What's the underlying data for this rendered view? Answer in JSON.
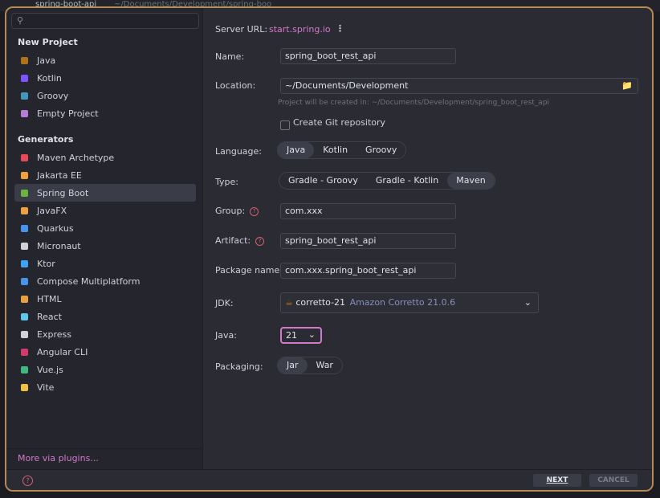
{
  "behind": {
    "title": "spring-boot-api",
    "path": "~/Documents/Development/spring-boo"
  },
  "sidebar": {
    "search_placeholder": "",
    "new_project_head": "New Project",
    "new_project_items": [
      {
        "label": "Java",
        "icon": "java-icon",
        "color": "#b07219"
      },
      {
        "label": "Kotlin",
        "icon": "kotlin-icon",
        "color": "#7f52ff"
      },
      {
        "label": "Groovy",
        "icon": "groovy-icon",
        "color": "#4298b8"
      },
      {
        "label": "Empty Project",
        "icon": "folder-icon",
        "color": "#b77dd6"
      }
    ],
    "generators_head": "Generators",
    "generator_items": [
      {
        "label": "Maven Archetype",
        "icon": "maven-icon",
        "color": "#e8495a"
      },
      {
        "label": "Jakarta EE",
        "icon": "jakarta-icon",
        "color": "#f0a040"
      },
      {
        "label": "Spring Boot",
        "icon": "spring-icon",
        "color": "#6db33f",
        "selected": true
      },
      {
        "label": "JavaFX",
        "icon": "javafx-icon",
        "color": "#f0a040"
      },
      {
        "label": "Quarkus",
        "icon": "quarkus-icon",
        "color": "#4695eb"
      },
      {
        "label": "Micronaut",
        "icon": "micronaut-icon",
        "color": "#cfd1d8"
      },
      {
        "label": "Ktor",
        "icon": "ktor-icon",
        "color": "#3fa3f5"
      },
      {
        "label": "Compose Multiplatform",
        "icon": "compose-icon",
        "color": "#4695eb"
      },
      {
        "label": "HTML",
        "icon": "html-icon",
        "color": "#e8a040"
      },
      {
        "label": "React",
        "icon": "react-icon",
        "color": "#5fc8e8"
      },
      {
        "label": "Express",
        "icon": "express-icon",
        "color": "#cfd1d8"
      },
      {
        "label": "Angular CLI",
        "icon": "angular-icon",
        "color": "#d63a6c"
      },
      {
        "label": "Vue.js",
        "icon": "vue-icon",
        "color": "#41b883"
      },
      {
        "label": "Vite",
        "icon": "vite-icon",
        "color": "#f0c040"
      }
    ],
    "more_plugins": "More via plugins..."
  },
  "form": {
    "server_url_label": "Server URL:",
    "server_url_value": "start.spring.io",
    "name_label": "Name:",
    "name_value": "spring_boot_rest_api",
    "location_label": "Location:",
    "location_value": "~/Documents/Development",
    "location_hint": "Project will be created in: ~/Documents/Development/spring_boot_rest_api",
    "git_label": "Create Git repository",
    "git_checked": false,
    "language_label": "Language:",
    "language_options": [
      "Java",
      "Kotlin",
      "Groovy"
    ],
    "language_selected": "Java",
    "type_label": "Type:",
    "type_options": [
      "Gradle - Groovy",
      "Gradle - Kotlin",
      "Maven"
    ],
    "type_selected": "Maven",
    "group_label": "Group:",
    "group_value": "com.xxx",
    "artifact_label": "Artifact:",
    "artifact_value": "spring_boot_rest_api",
    "package_label": "Package name:",
    "package_value": "com.xxx.spring_boot_rest_api",
    "jdk_label": "JDK:",
    "jdk_name": "corretto-21",
    "jdk_detail": "Amazon Corretto 21.0.6",
    "java_label": "Java:",
    "java_value": "21",
    "packaging_label": "Packaging:",
    "packaging_options": [
      "Jar",
      "War"
    ],
    "packaging_selected": "Jar"
  },
  "footer": {
    "next": "NEXT",
    "cancel": "CANCEL"
  },
  "colors": {
    "accent": "#d279c9",
    "dialog_border": "#b48a55",
    "help": "#d15f72"
  }
}
